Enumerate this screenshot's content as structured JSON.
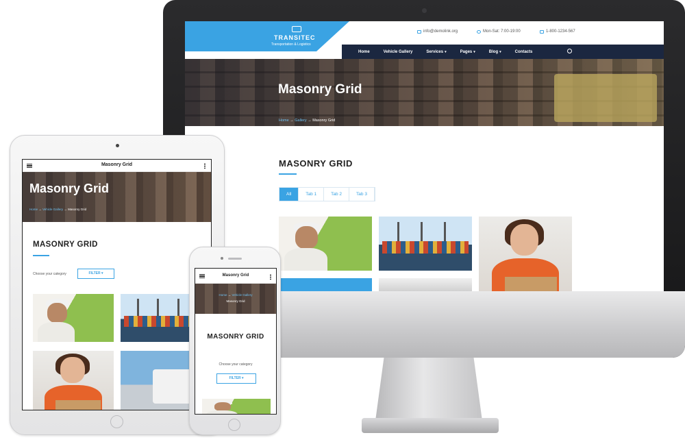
{
  "desktop": {
    "brand": {
      "name": "TRANSITEC",
      "tagline": "Transportation & Logistics"
    },
    "contacts": [
      {
        "icon": "mail-icon",
        "text": "info@demolink.org"
      },
      {
        "icon": "clock-icon",
        "text": "Mon-Sat: 7:00-19:00"
      },
      {
        "icon": "phone-icon",
        "text": "1-800-1234-567"
      }
    ],
    "nav": [
      {
        "label": "Home",
        "dropdown": false
      },
      {
        "label": "Vehicle Gallery",
        "dropdown": false
      },
      {
        "label": "Services",
        "dropdown": true
      },
      {
        "label": "Pages",
        "dropdown": true
      },
      {
        "label": "Blog",
        "dropdown": true
      },
      {
        "label": "Contacts",
        "dropdown": false
      }
    ],
    "hero": {
      "title": "Masonry Grid"
    },
    "breadcrumb": {
      "home": "Home",
      "sep": "→",
      "gallery": "Gallery",
      "current": "Masonry Grid"
    },
    "section_title": "MASONRY GRID",
    "tabs": [
      "All",
      "Tab 1",
      "Tab 2",
      "Tab 3"
    ],
    "active_tab": "All"
  },
  "tablet": {
    "bar_title": "Masonry Grid",
    "hero": {
      "title": "Masonry Grid"
    },
    "breadcrumb": {
      "home": "Home",
      "sep": "→",
      "gallery": "Vehicle Gallery",
      "current": "Masonry Grid"
    },
    "section_title": "MASONRY GRID",
    "choose_label": "Choose your category",
    "filter_label": "FILTER ▾"
  },
  "phone": {
    "bar_title": "Masonry Grid",
    "breadcrumb": {
      "home": "Home",
      "sep": "→",
      "gallery": "Vehicle Gallery",
      "current": "Masonry Grid"
    },
    "section_title": "MASONRY GRID",
    "choose_label": "Choose your category",
    "filter_label": "FILTER ▾"
  },
  "colors": {
    "accent": "#3aa3e3",
    "nav_bg": "#1b2740"
  }
}
